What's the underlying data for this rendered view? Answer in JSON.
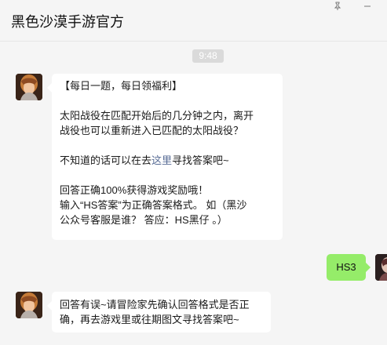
{
  "header": {
    "title": "黑色沙漠手游官方"
  },
  "chat": {
    "timestamp": "9:48",
    "messages": [
      {
        "lines": [
          "【每日一题，每日领福利】",
          "",
          "太阳战役在匹配开始后的几分钟之内，离开",
          "战役也可以重新进入已匹配的太阳战役？",
          "",
          "不知道的话可以在去",
          "这里",
          "寻找答案吧~",
          "",
          "回答正确100%获得游戏奖励哦！",
          "输入“HS答案”为正确答案格式。 如（黑沙",
          "公众号客服是谁？ 答应：HS黑仔 。）"
        ]
      },
      {
        "text": "HS3"
      },
      {
        "lines": [
          "回答有误~请冒险家先确认回答格式是否正",
          "确，再去游戏里或往期图文寻找答案吧~"
        ]
      }
    ]
  },
  "icons": {
    "pin": "pin-icon",
    "minimize": "minimize-icon"
  }
}
